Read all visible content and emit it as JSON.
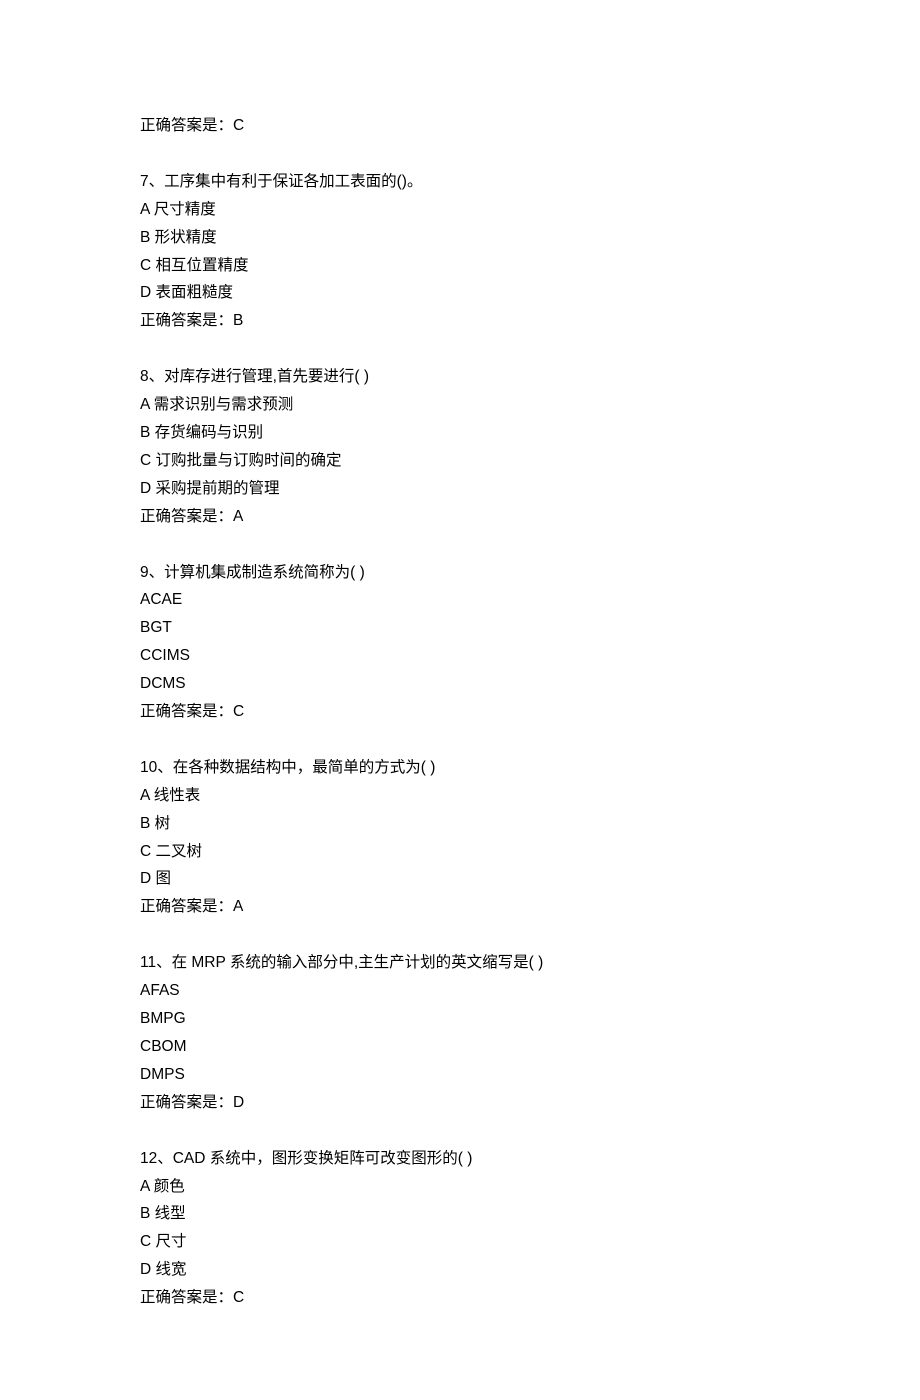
{
  "blocks": [
    {
      "lines": [
        "正确答案是：C"
      ]
    },
    {
      "lines": [
        "7、工序集中有利于保证各加工表面的()。",
        "A 尺寸精度",
        "B 形状精度",
        "C 相互位置精度",
        "D 表面粗糙度",
        "正确答案是：B"
      ]
    },
    {
      "lines": [
        "8、对库存进行管理,首先要进行( )",
        "A 需求识别与需求预测",
        "B 存货编码与识别",
        "C 订购批量与订购时间的确定",
        "D 采购提前期的管理",
        "正确答案是：A"
      ]
    },
    {
      "lines": [
        "9、计算机集成制造系统简称为( )",
        "ACAE",
        "BGT",
        "CCIMS",
        "DCMS",
        "正确答案是：C"
      ]
    },
    {
      "lines": [
        "10、在各种数据结构中，最简单的方式为( )",
        "A 线性表",
        "B 树",
        "C 二叉树",
        "D 图",
        "正确答案是：A"
      ]
    },
    {
      "lines": [
        "11、在 MRP 系统的输入部分中,主生产计划的英文缩写是( )",
        "AFAS",
        "BMPG",
        "CBOM",
        "DMPS",
        "正确答案是：D"
      ]
    },
    {
      "lines": [
        "12、CAD 系统中，图形变换矩阵可改变图形的( )",
        "A 颜色",
        "B 线型",
        "C 尺寸",
        "D 线宽",
        "正确答案是：C"
      ]
    }
  ]
}
